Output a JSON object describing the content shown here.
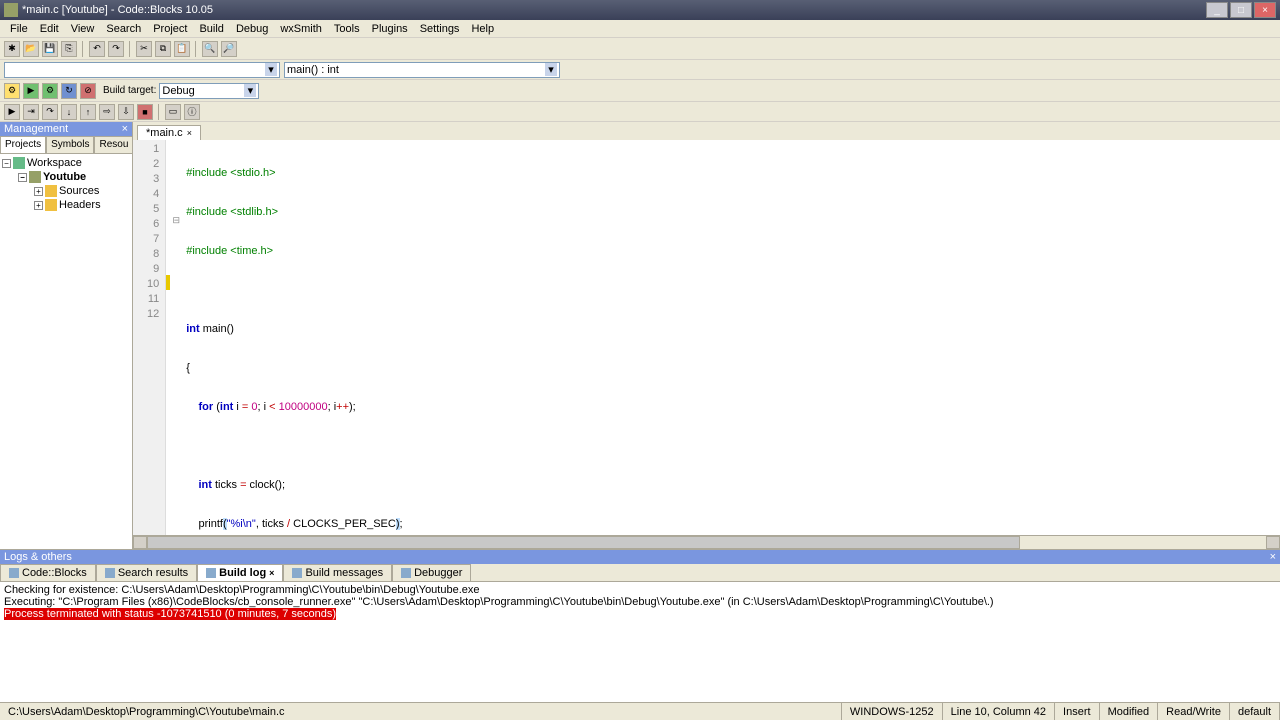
{
  "title": "*main.c [Youtube] - Code::Blocks 10.05",
  "menus": [
    "File",
    "Edit",
    "View",
    "Search",
    "Project",
    "Build",
    "Debug",
    "wxSmith",
    "Tools",
    "Plugins",
    "Settings",
    "Help"
  ],
  "combo_fn": "",
  "combo_scope": "main() : int",
  "build_target_label": "Build target:",
  "build_target": "Debug",
  "sidebar": {
    "title": "Management",
    "tabs": [
      "Projects",
      "Symbols",
      "Resou"
    ],
    "tree": {
      "workspace": "Workspace",
      "project": "Youtube",
      "folders": [
        "Sources",
        "Headers"
      ]
    }
  },
  "editor": {
    "tab": "*main.c",
    "lines": [
      1,
      2,
      3,
      4,
      5,
      6,
      7,
      8,
      9,
      10,
      11,
      12
    ],
    "code": {
      "l1": {
        "pp": "#include ",
        "inc": "<stdio.h>"
      },
      "l2": {
        "pp": "#include ",
        "inc": "<stdlib.h>"
      },
      "l3": {
        "pp": "#include ",
        "inc": "<time.h>"
      },
      "l5": {
        "kw": "int",
        "fn": " main",
        "p": "()"
      },
      "l6": "{",
      "l7": {
        "kw1": "for",
        "p1": " (",
        "kw2": "int",
        "v": " i ",
        "op1": "=",
        "n1": " 0",
        "s1": "; i ",
        "op2": "<",
        "n2": " 10000000",
        "s2": "; i",
        "op3": "++",
        ")": ");"
      },
      "l9": {
        "kw": "int",
        "v": " ticks ",
        "op": "=",
        "fn": " clock",
        "p": "();"
      },
      "l10": {
        "fn": "printf",
        "p1": "(",
        "str": "\"%i\\n\"",
        "s": ", ticks ",
        "op": "/",
        "c": " CLOCKS_PER_SEC",
        "p2": ")",
        ";": ";"
      },
      "l11": "}"
    }
  },
  "bottom": {
    "title": "Logs & others",
    "tabs": [
      "Code::Blocks",
      "Search results",
      "Build log",
      "Build messages",
      "Debugger"
    ],
    "active": 2,
    "log": {
      "l1": "Checking for existence: C:\\Users\\Adam\\Desktop\\Programming\\C\\Youtube\\bin\\Debug\\Youtube.exe",
      "l2": "Executing: \"C:\\Program Files (x86)\\CodeBlocks/cb_console_runner.exe\" \"C:\\Users\\Adam\\Desktop\\Programming\\C\\Youtube\\bin\\Debug\\Youtube.exe\"  (in C:\\Users\\Adam\\Desktop\\Programming\\C\\Youtube\\.)",
      "l3": "Process terminated with status -1073741510 (0 minutes, 7 seconds)"
    }
  },
  "status": {
    "path": "C:\\Users\\Adam\\Desktop\\Programming\\C\\Youtube\\main.c",
    "enc": "WINDOWS-1252",
    "pos": "Line 10, Column 42",
    "ins": "Insert",
    "mod": "Modified",
    "rw": "Read/Write",
    "prof": "default"
  }
}
